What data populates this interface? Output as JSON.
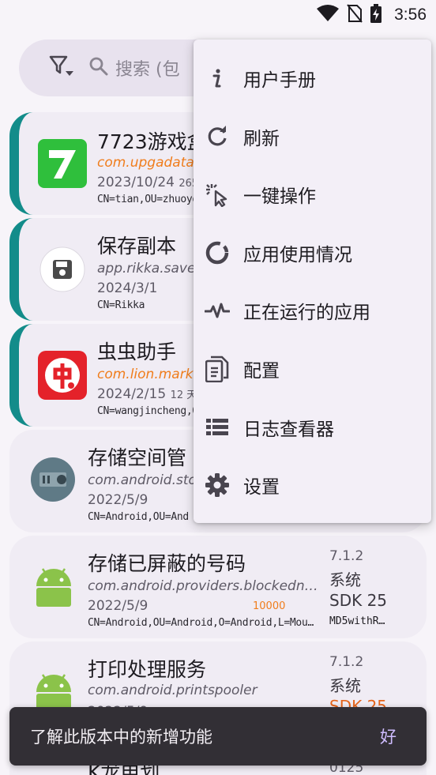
{
  "status_bar": {
    "time": "3:56"
  },
  "search": {
    "placeholder": "搜索 (包"
  },
  "apps": [
    {
      "name": "7723游戏盒",
      "package": "com.upgadata.u",
      "date": "2023/10/24",
      "date_extra": "265",
      "cert": "CN=tian,OU=zhuoyou"
    },
    {
      "name": "保存副本",
      "package": "app.rikka.savec",
      "date": "2024/3/1",
      "cert": "CN=Rikka"
    },
    {
      "name": "虫虫助手",
      "package": "com.lion.market",
      "date": "2024/2/15",
      "date_extra": "12 天",
      "cert": "CN=wangjincheng,OU"
    },
    {
      "name": "存储空间管",
      "package": "com.android.sto",
      "date": "2022/5/9",
      "cert": "CN=Android,OU=And"
    },
    {
      "name": "存储已屏蔽的号码",
      "package": "com.android.providers.blockedn…",
      "date": "2022/5/9",
      "uid": "10000",
      "cert": "CN=Android,OU=Android,O=Android,L=Mou…",
      "version": "7.1.2",
      "type": "系统",
      "sdk": "SDK 25",
      "sig": "MD5withR…"
    },
    {
      "name": "打印处理服务",
      "package": "com.android.printspooler",
      "date": "2022/5/9",
      "version": "7.1.2",
      "type": "系统",
      "sdk": "SDK 25"
    },
    {
      "name": "K龙电划",
      "side": "0125"
    }
  ],
  "menu": {
    "items": [
      {
        "label": "用户手册",
        "icon": "info-icon"
      },
      {
        "label": "刷新",
        "icon": "refresh-icon"
      },
      {
        "label": "一键操作",
        "icon": "tap-cursor-icon"
      },
      {
        "label": "应用使用情况",
        "icon": "usage-ring-icon"
      },
      {
        "label": "正在运行的应用",
        "icon": "pulse-icon"
      },
      {
        "label": "配置",
        "icon": "document-icon"
      },
      {
        "label": "日志查看器",
        "icon": "list-icon"
      },
      {
        "label": "设置",
        "icon": "gear-icon"
      }
    ]
  },
  "snackbar": {
    "message": "了解此版本中的新增功能",
    "action": "好"
  },
  "colors": {
    "accent": "#138c8a",
    "package_highlight": "#f07d1c",
    "snackbar_bg": "#322f35",
    "snackbar_action": "#cfbcff"
  }
}
